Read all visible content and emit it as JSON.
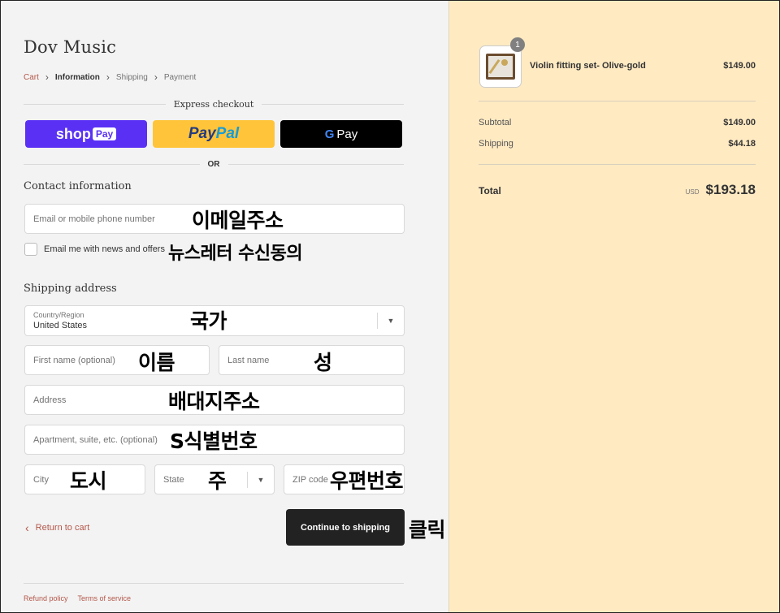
{
  "shop": {
    "name": "Dov Music"
  },
  "breadcrumb": {
    "cart": "Cart",
    "information": "Information",
    "shipping": "Shipping",
    "payment": "Payment"
  },
  "express": {
    "title": "Express checkout",
    "or": "OR",
    "shoppay_label": "shop",
    "shoppay_chip": "Pay",
    "paypal_a": "Pay",
    "paypal_b": "Pal",
    "gpay_g": "G",
    "gpay_label": "Pay"
  },
  "contact": {
    "title": "Contact information",
    "email_placeholder": "Email or mobile phone number",
    "email_annotation": "이메일주소",
    "newsletter_label": "Email me with news and offers",
    "newsletter_annotation": "뉴스레터 수신동의"
  },
  "shipping": {
    "title": "Shipping address",
    "country_label": "Country/Region",
    "country_value": "United States",
    "country_annotation": "국가",
    "first_name_placeholder": "First name (optional)",
    "first_name_annotation": "이름",
    "last_name_placeholder": "Last name",
    "last_name_annotation": "성",
    "address_placeholder": "Address",
    "address_annotation": "배대지주소",
    "apartment_placeholder": "Apartment, suite, etc. (optional)",
    "apartment_annotation": "S식별번호",
    "city_placeholder": "City",
    "city_annotation": "도시",
    "state_placeholder": "State",
    "state_annotation": "주",
    "zip_placeholder": "ZIP code",
    "zip_annotation": "우편번호"
  },
  "actions": {
    "return_label": "Return to cart",
    "continue_label": "Continue to shipping",
    "continue_annotation": "클릭"
  },
  "footer": {
    "refund": "Refund policy",
    "terms": "Terms of service"
  },
  "order": {
    "item_name": "Violin fitting set- Olive-gold",
    "item_price": "$149.00",
    "item_qty": "1",
    "subtotal_label": "Subtotal",
    "subtotal_value": "$149.00",
    "shipping_label": "Shipping",
    "shipping_value": "$44.18",
    "total_label": "Total",
    "currency": "USD",
    "total_value": "$193.18"
  }
}
